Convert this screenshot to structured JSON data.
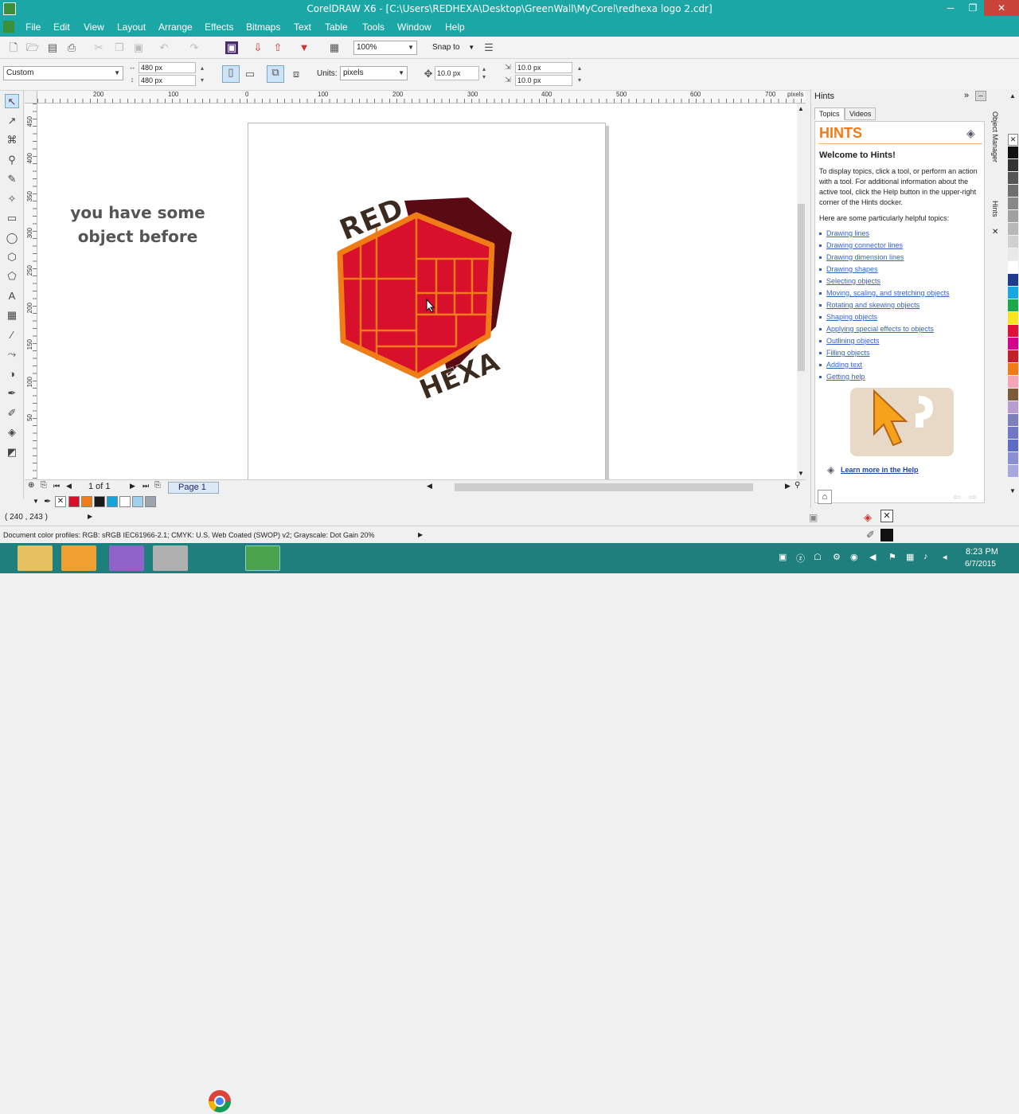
{
  "window": {
    "title": "CorelDRAW X6 - [C:\\Users\\REDHEXA\\Desktop\\GreenWall\\MyCorel\\redhexa logo 2.cdr]",
    "minimize": "─",
    "restore": "❐",
    "close": "✕"
  },
  "menu": [
    "File",
    "Edit",
    "View",
    "Layout",
    "Arrange",
    "Effects",
    "Bitmaps",
    "Text",
    "Table",
    "Tools",
    "Window",
    "Help"
  ],
  "toolbar": {
    "zoom": "100%",
    "snap_to": "Snap to"
  },
  "propertybar": {
    "preset": "Custom",
    "width": "480 px",
    "height": "480 px",
    "units_label": "Units:",
    "units": "pixels",
    "nudge": "10.0 px",
    "dup_x": "10.0 px",
    "dup_y": "10.0 px"
  },
  "ruler": {
    "h_labels": [
      "200",
      "100",
      "0",
      "100",
      "200",
      "300",
      "400",
      "500",
      "600",
      "700",
      "pixels"
    ],
    "v_labels": [
      "450",
      "400",
      "350",
      "300",
      "250",
      "200",
      "150",
      "100",
      "50"
    ]
  },
  "canvas": {
    "note": "you have some object before",
    "logo_top": "RED",
    "logo_bottom": "HEXA"
  },
  "pagenav": {
    "count": "1 of 1",
    "page_tab": "Page 1"
  },
  "status": {
    "coords": "( 240 , 243 )",
    "profiles": "Document color profiles: RGB: sRGB IEC61966-2.1; CMYK: U.S. Web Coated (SWOP) v2; Grayscale: Dot Gain 20%"
  },
  "docker": {
    "header": "Hints",
    "tabs": [
      "Topics",
      "Videos"
    ],
    "title": "HINTS",
    "welcome": "Welcome to Hints!",
    "intro": "To display topics, click a tool, or perform an action with a tool. For additional information about the active tool, click the Help button in the upper-right corner of the Hints docker.",
    "helpful": "Here are some particularly helpful topics:",
    "links": [
      "Drawing lines",
      "Drawing connector lines",
      "Drawing dimension lines",
      "Drawing shapes",
      "Selecting objects",
      "Moving, scaling, and stretching objects",
      "Rotating and skewing objects",
      "Shaping objects",
      "Applying special effects to objects",
      "Outlining objects",
      "Filling objects",
      "Adding text",
      "Getting help"
    ],
    "learn_more": "Learn more in the Help",
    "side_tabs": [
      "Object Manager",
      "Hints"
    ]
  },
  "clock": {
    "time": "8:23 PM",
    "date": "6/7/2015"
  },
  "colors": {
    "teal": "#1aa7a5",
    "logo_red": "#d8102b",
    "logo_orange": "#f07c17",
    "logo_dark": "#5a0a12",
    "link": "#3562c8"
  }
}
